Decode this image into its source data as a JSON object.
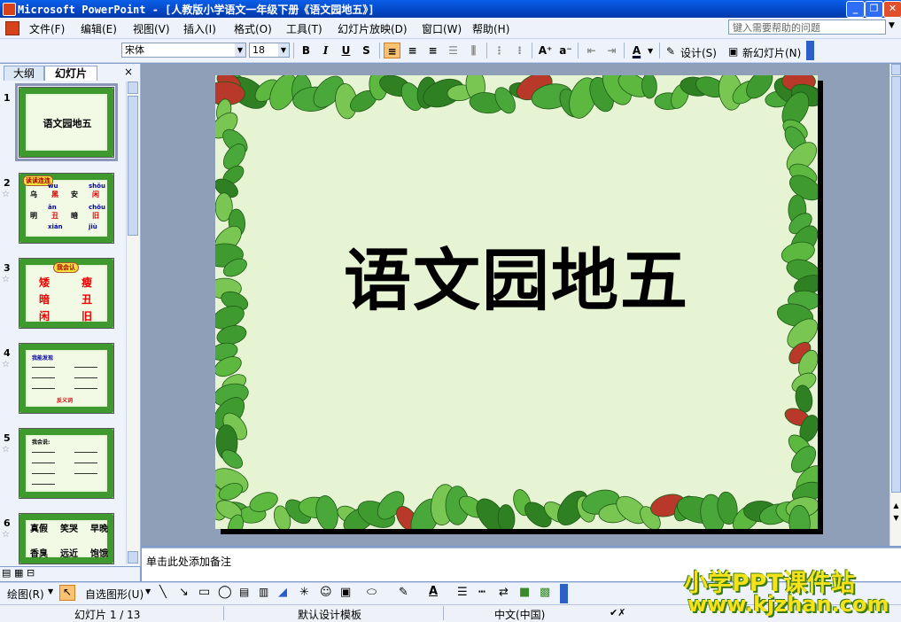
{
  "window": {
    "title": "Microsoft PowerPoint - [人教版小学语文一年级下册《语文园地五》]"
  },
  "menu": {
    "items": [
      "文件(F)",
      "编辑(E)",
      "视图(V)",
      "插入(I)",
      "格式(O)",
      "工具(T)",
      "幻灯片放映(D)",
      "窗口(W)",
      "帮助(H)"
    ],
    "help_placeholder": "键入需要帮助的问题"
  },
  "toolbar": {
    "font": "宋体",
    "size": "18",
    "bold": "B",
    "italic": "I",
    "underline": "U",
    "shadow": "S",
    "design": "设计(S)",
    "new_slide": "新幻灯片(N)"
  },
  "panes": {
    "tab_outline": "大纲",
    "tab_slides": "幻灯片",
    "close": "×"
  },
  "thumbnails": [
    {
      "num": "1",
      "title": "语文园地五"
    },
    {
      "num": "2",
      "star": "☆",
      "banner": "读读连连",
      "pinyin": [
        "wu",
        "shǒu",
        "ān",
        "chǒu",
        "xián",
        "jiù"
      ],
      "left": [
        "乌",
        "明",
        "安",
        "暗"
      ],
      "right": [
        "黑",
        "丑",
        "闲",
        "旧"
      ]
    },
    {
      "num": "3",
      "star": "☆",
      "banner": "我会认",
      "chars": [
        "矮",
        "瘦",
        "暗",
        "丑",
        "闲",
        "旧"
      ]
    },
    {
      "num": "4",
      "star": "☆",
      "head": "我能发现",
      "footer": "反义词"
    },
    {
      "num": "5",
      "star": "☆",
      "head": "我会说:"
    },
    {
      "num": "6",
      "star": "☆",
      "row1": [
        "真假",
        "笑哭",
        "早晚"
      ],
      "row2": [
        "香臭",
        "远近",
        "饱饿"
      ]
    }
  ],
  "slide": {
    "title": "语文园地五"
  },
  "notes": {
    "placeholder": "单击此处添加备注"
  },
  "drawbar": {
    "draw": "绘图(R)",
    "autoshape": "自选图形(U)"
  },
  "status": {
    "slide": "幻灯片 1 / 13",
    "template": "默认设计模板",
    "lang": "中文(中国)"
  },
  "watermark": {
    "line1": "小学PPT课件站",
    "line2": "www.kjzhan.com"
  }
}
